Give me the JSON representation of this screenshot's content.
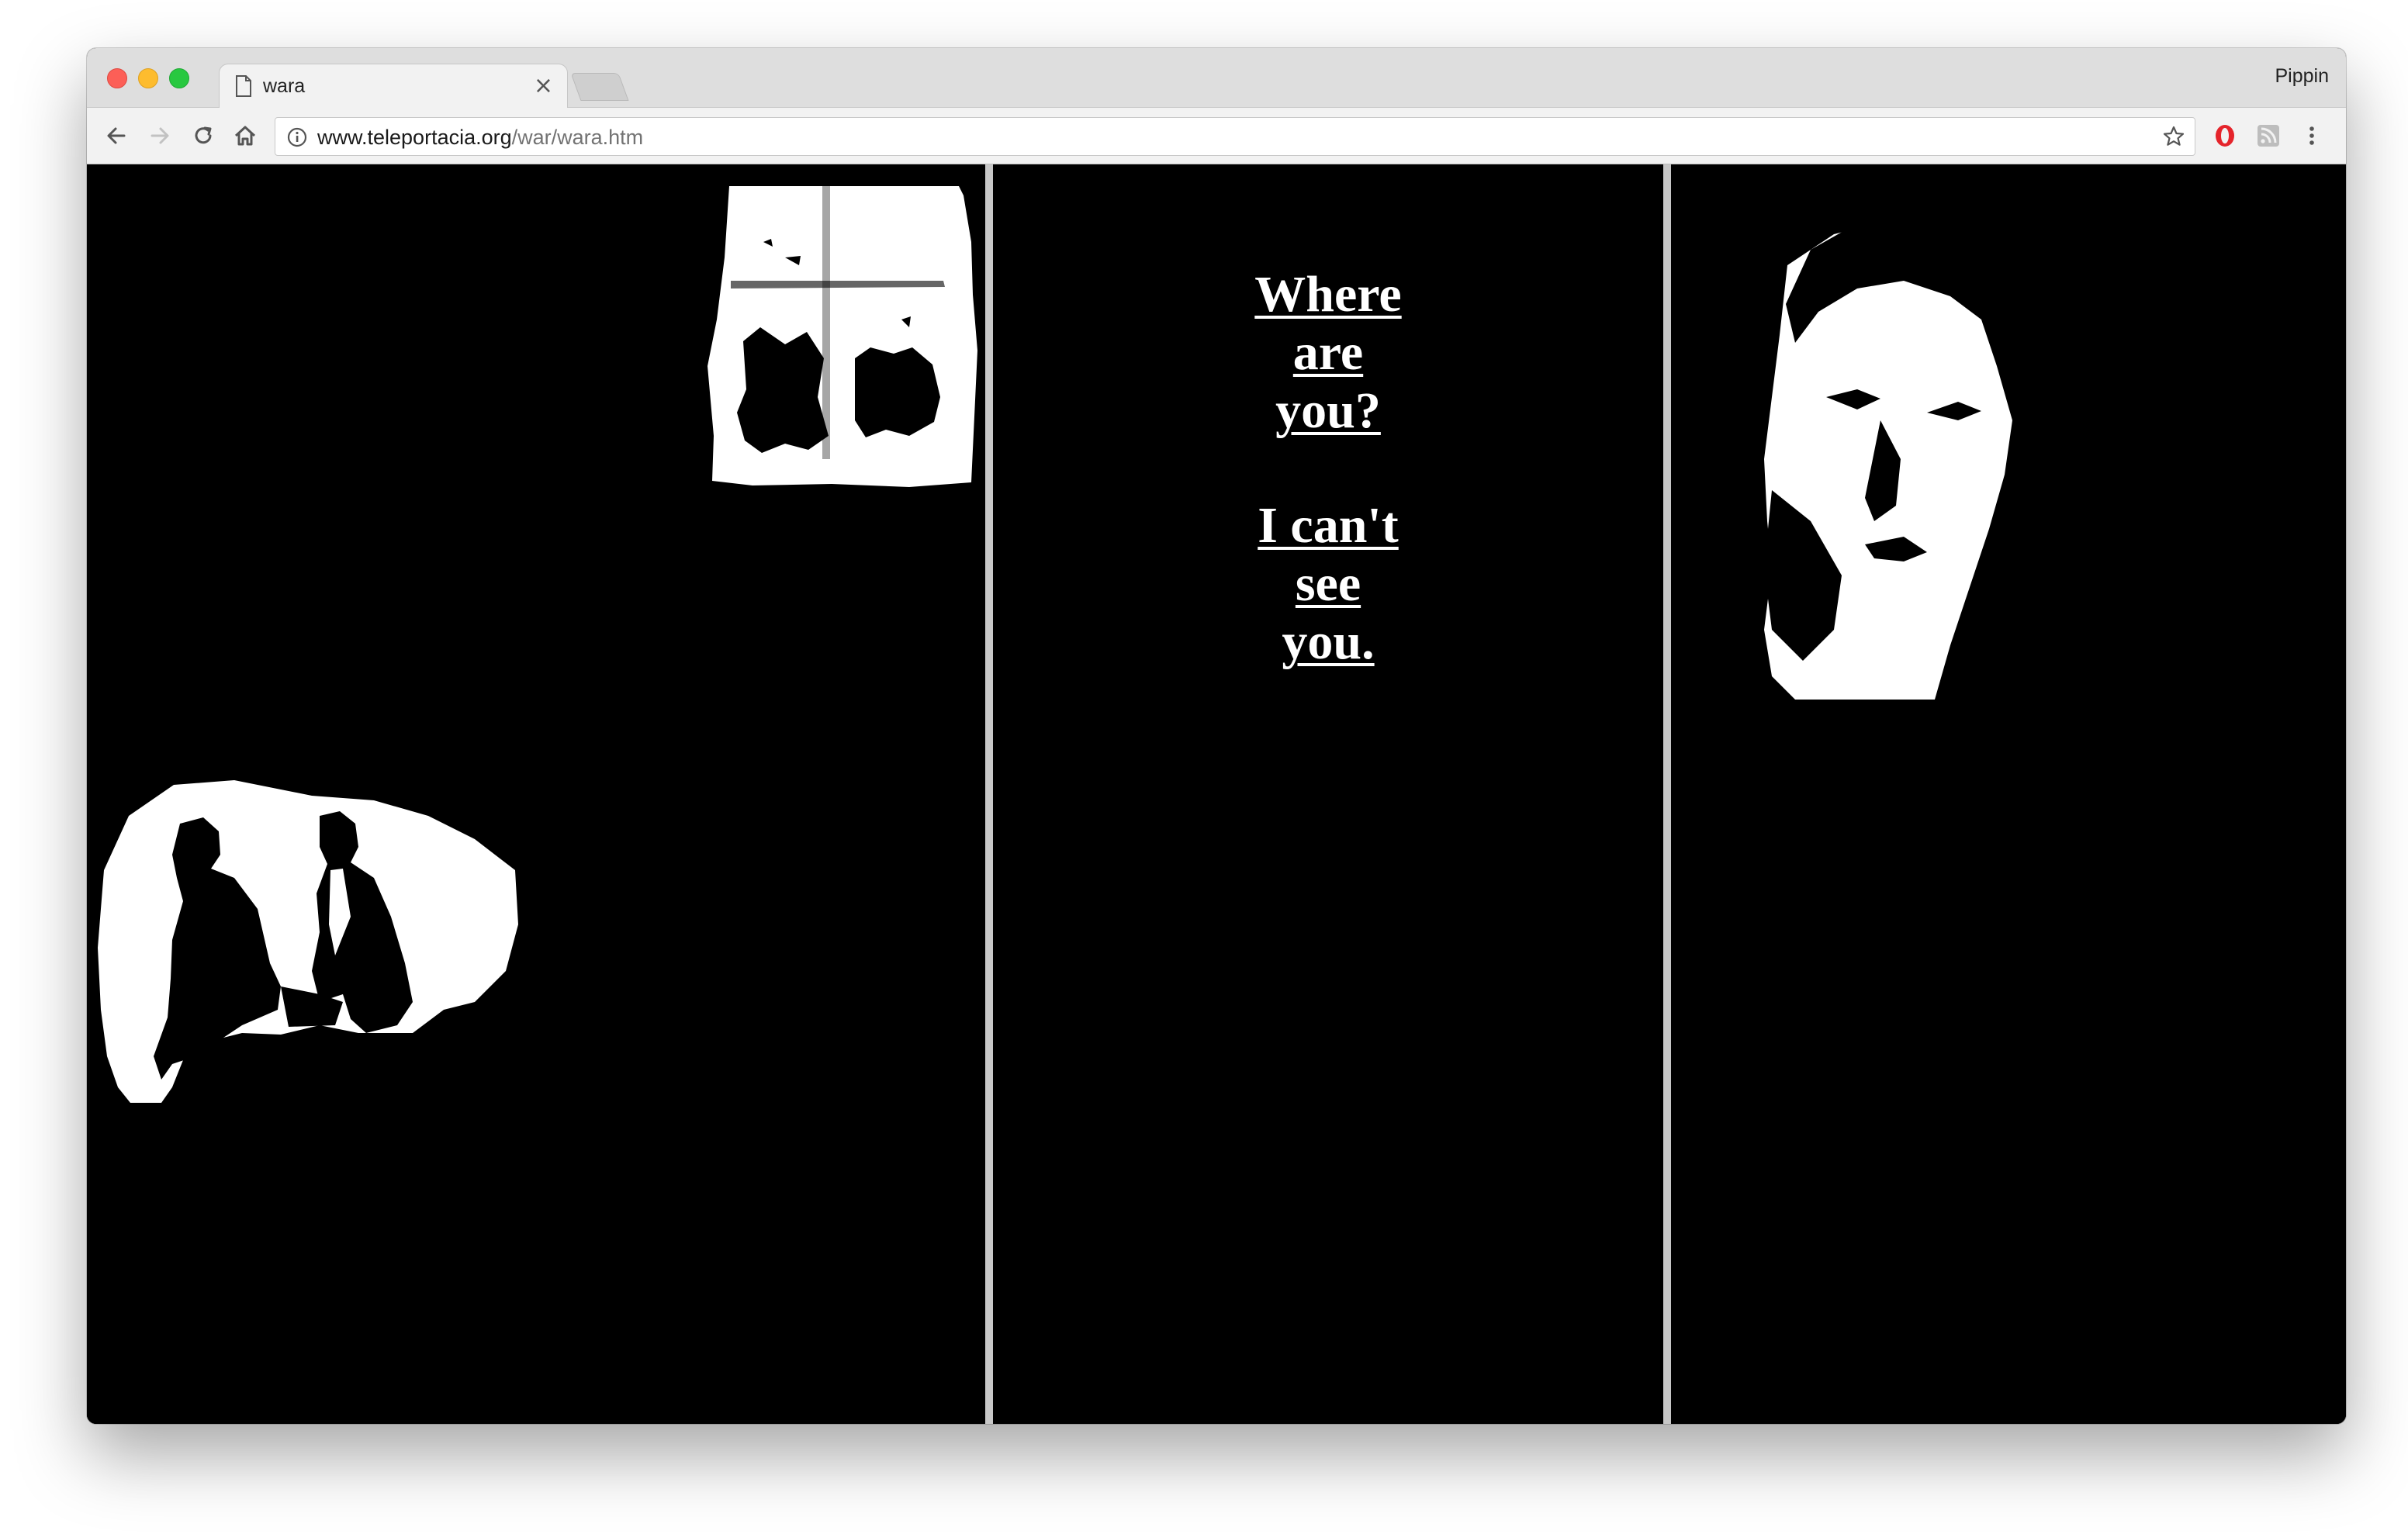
{
  "browser": {
    "tab": {
      "title": "wara",
      "close_glyph": "×"
    },
    "profile_name": "Pippin",
    "address": {
      "host": "www.teleportacia.org",
      "path": "/war/wara.htm"
    },
    "icons": {
      "back": "back-arrow-icon",
      "forward": "forward-arrow-icon",
      "reload": "reload-icon",
      "home": "home-icon",
      "site_info": "info-icon",
      "bookmark": "star-icon",
      "opera_extension": "opera-icon",
      "rss_extension": "rss-icon",
      "menu": "more-vertical-icon"
    }
  },
  "page": {
    "poem": {
      "link1": [
        "Where",
        "are ",
        "you?"
      ],
      "link2": [
        "I can't ",
        "see ",
        "you."
      ]
    }
  }
}
